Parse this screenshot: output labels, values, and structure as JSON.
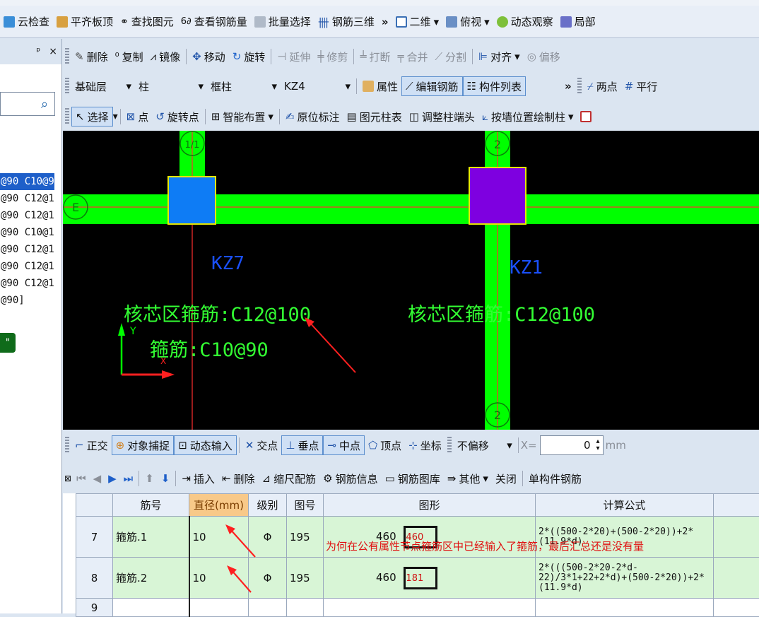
{
  "toolbar1": {
    "items": [
      "云检查",
      "平齐板顶",
      "查找图元",
      "查看钢筋量",
      "批量选择",
      "钢筋三维",
      "二维",
      "俯视",
      "动态观察",
      "局部"
    ]
  },
  "left_panel": {
    "pin": "ᵖ",
    "close": "×",
    "rows": [
      "@90 C10@9",
      "@90 C12@1",
      "@90 C12@1",
      "@90 C10@1",
      "@90 C12@1",
      "@90 C12@1",
      "@90 C12@1",
      "@90]"
    ],
    "green_btn": "\""
  },
  "toolbar2": {
    "items": [
      "删除",
      "复制",
      "镜像",
      "移动",
      "旋转",
      "延伸",
      "修剪",
      "打断",
      "合并",
      "分割",
      "对齐",
      "偏移"
    ]
  },
  "toolbar3": {
    "floor": "基础层",
    "type": "柱",
    "subtype": "框柱",
    "name": "KZ4",
    "items": [
      "属性",
      "编辑钢筋",
      "构件列表",
      "两点",
      "平行"
    ]
  },
  "toolbar4": {
    "items": [
      "选择",
      "点",
      "旋转点",
      "智能布置",
      "原位标注",
      "图元柱表",
      "调整柱端头",
      "按墙位置绘制柱"
    ]
  },
  "canvas": {
    "axis_labels": [
      "1/1",
      "2",
      "E",
      "2"
    ],
    "col1_label": "KZ7",
    "col2_label": "KZ1",
    "core1_text": "核芯区箍筋:C12@100",
    "core2_text": "核芯区箍筋:C12@100",
    "stirrup_text": "箍筋:C10@90",
    "y_axis": "Y",
    "x_axis": "X",
    "colors": {
      "beam": "#00ff00",
      "col1": "#0e7cf5",
      "col2": "#7e00e0",
      "label": "#1a50ff",
      "note": "#33ff33",
      "arrow": "#ff2020"
    }
  },
  "snapbar": {
    "items": [
      "正交",
      "对象捕捉",
      "动态输入",
      "交点",
      "垂点",
      "中点",
      "顶点",
      "坐标"
    ],
    "offset_mode": "不偏移",
    "x_label": "X=",
    "x_value": "0",
    "unit": "mm"
  },
  "grid_toolbar": {
    "items": [
      "插入",
      "删除",
      "缩尺配筋",
      "钢筋信息",
      "钢筋图库",
      "其他",
      "关闭",
      "单构件钢筋"
    ]
  },
  "grid": {
    "headers": [
      "筋号",
      "直径(mm)",
      "级别",
      "图号",
      "图形",
      "计算公式"
    ],
    "rows": [
      {
        "idx": "7",
        "name": "箍筋.1",
        "dia": "10",
        "grade": "Φ",
        "fig": "195",
        "shape_len": "460",
        "shape_in": "460",
        "formula": "2*((500-2*20)+(500-2*20))+2*(11.9*d)"
      },
      {
        "idx": "8",
        "name": "箍筋.2",
        "dia": "10",
        "grade": "Φ",
        "fig": "195",
        "shape_len": "460",
        "shape_in": "181",
        "formula": "2*(((500-2*20-2*d-22)/3*1+22+2*d)+(500-2*20))+2*(11.9*d)"
      }
    ],
    "empty_idx": "9"
  },
  "annotation": "为何在公有属性节点箍筋区中已经输入了箍筋，最后汇总还是没有量"
}
